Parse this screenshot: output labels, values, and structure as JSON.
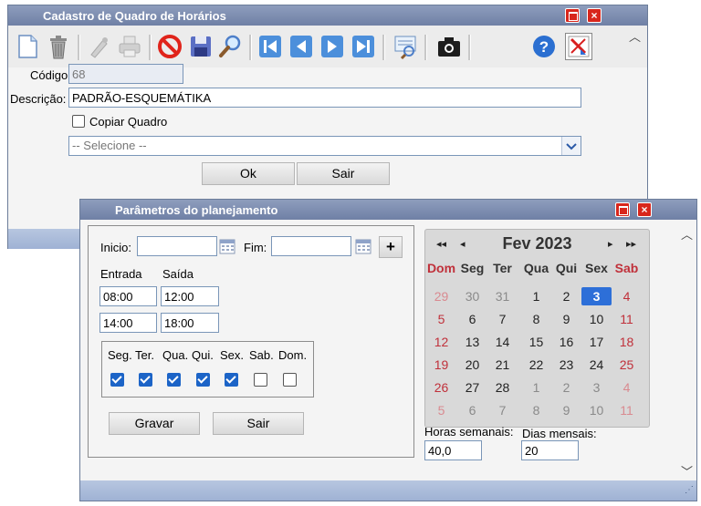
{
  "main_window": {
    "title": "Cadastro de Quadro de Horários",
    "toolbar_icons": [
      "new-document-icon",
      "trash-icon",
      "edit-icon",
      "print-icon",
      "cancel-icon",
      "save-icon",
      "search-icon",
      "first-record-icon",
      "previous-record-icon",
      "next-record-icon",
      "last-record-icon",
      "filter-icon",
      "camera-icon",
      "help-icon",
      "planning-icon"
    ],
    "codigo_label": "Código:",
    "codigo_value": "68",
    "descricao_label": "Descrição:",
    "descricao_value": "PADRÃO-ESQUEMÁTIKA",
    "copiar_label": "Copiar Quadro",
    "select_value": "-- Selecione --",
    "ok_label": "Ok",
    "sair_label": "Sair"
  },
  "dialog": {
    "title": "Parâmetros do planejamento",
    "inicio_label": "Inicio:",
    "inicio_value": "",
    "fim_label": "Fim:",
    "fim_value": "",
    "add_label": "+",
    "entrada_label": "Entrada",
    "saida_label": "Saída",
    "times": [
      {
        "entrada": "08:00",
        "saida": "12:00"
      },
      {
        "entrada": "14:00",
        "saida": "18:00"
      }
    ],
    "weekdays": [
      {
        "label": "Seg.",
        "checked": true
      },
      {
        "label": "Ter.",
        "checked": true
      },
      {
        "label": "Qua.",
        "checked": true
      },
      {
        "label": "Qui.",
        "checked": true
      },
      {
        "label": "Sex.",
        "checked": true
      },
      {
        "label": "Sab.",
        "checked": false
      },
      {
        "label": "Dom.",
        "checked": false
      }
    ],
    "gravar_label": "Gravar",
    "sair_label": "Sair",
    "horas_label": "Horas semanais:",
    "horas_value": "40,0",
    "dias_label": "Dias mensais:",
    "dias_value": "20",
    "calendar": {
      "month_label": "Fev 2023",
      "nav": {
        "prev_year": "◂◂",
        "prev_month": "◂",
        "next_month": "▸",
        "next_year": "▸▸"
      },
      "weekdays": [
        "Dom",
        "Seg",
        "Ter",
        "Qua",
        "Qui",
        "Sex",
        "Sab"
      ],
      "weeks": [
        [
          "29",
          "30",
          "31",
          "1",
          "2",
          "3",
          "4"
        ],
        [
          "5",
          "6",
          "7",
          "8",
          "9",
          "10",
          "11"
        ],
        [
          "12",
          "13",
          "14",
          "15",
          "16",
          "17",
          "18"
        ],
        [
          "19",
          "20",
          "21",
          "22",
          "23",
          "24",
          "25"
        ],
        [
          "26",
          "27",
          "28",
          "1",
          "2",
          "3",
          "4"
        ],
        [
          "5",
          "6",
          "7",
          "8",
          "9",
          "10",
          "11"
        ]
      ],
      "selected_day": "3",
      "accent_color": "#2d6fd8",
      "weekend_color": "#c0303a"
    }
  }
}
